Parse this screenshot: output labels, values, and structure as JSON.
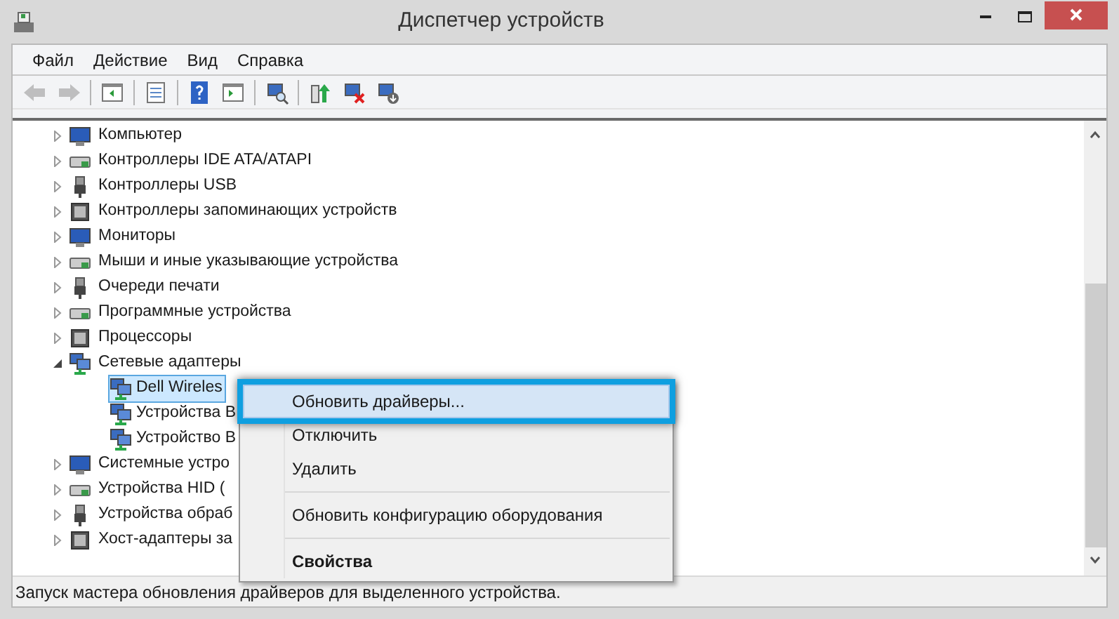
{
  "window": {
    "title": "Диспетчер устройств"
  },
  "menu_bar": [
    "Файл",
    "Действие",
    "Вид",
    "Справка"
  ],
  "toolbar": [
    {
      "kind": "back",
      "disabled": true
    },
    {
      "kind": "forward",
      "disabled": true
    },
    {
      "kind": "separator"
    },
    {
      "kind": "tree"
    },
    {
      "kind": "separator"
    },
    {
      "kind": "properties"
    },
    {
      "kind": "separator"
    },
    {
      "kind": "help"
    },
    {
      "kind": "pane"
    },
    {
      "kind": "separator"
    },
    {
      "kind": "scan"
    },
    {
      "kind": "separator"
    },
    {
      "kind": "update"
    },
    {
      "kind": "uninstall"
    },
    {
      "kind": "disable"
    }
  ],
  "tree": [
    {
      "label": "Компьютер",
      "expanded": false,
      "selected": false
    },
    {
      "label": "Контроллеры IDE ATA/ATAPI",
      "expanded": false,
      "selected": false
    },
    {
      "label": "Контроллеры USB",
      "expanded": false,
      "selected": false
    },
    {
      "label": "Контроллеры запоминающих устройств",
      "expanded": false,
      "selected": false
    },
    {
      "label": "Мониторы",
      "expanded": false,
      "selected": false
    },
    {
      "label": "Мыши и иные указывающие устройства",
      "expanded": false,
      "selected": false
    },
    {
      "label": "Очереди печати",
      "expanded": false,
      "selected": false
    },
    {
      "label": "Программные устройства",
      "expanded": false,
      "selected": false
    },
    {
      "label": "Процессоры",
      "expanded": false,
      "selected": false
    },
    {
      "label": "Сетевые адаптеры",
      "expanded": true,
      "selected": false,
      "children": [
        {
          "label": "Dell Wireles",
          "selected": true
        },
        {
          "label": "Устройства B",
          "selected": false
        },
        {
          "label": "Устройство B",
          "selected": false
        }
      ]
    },
    {
      "label": "Системные устро",
      "expanded": false,
      "selected": false
    },
    {
      "label": "Устройства HID (",
      "expanded": false,
      "selected": false
    },
    {
      "label": "Устройства обраб",
      "expanded": false,
      "selected": false
    },
    {
      "label": "Хост-адаптеры за",
      "expanded": false,
      "selected": false
    }
  ],
  "context_menu": [
    {
      "kind": "item",
      "label": "Обновить драйверы...",
      "selected": true,
      "default": false
    },
    {
      "kind": "item",
      "label": "Отключить",
      "selected": false,
      "default": false
    },
    {
      "kind": "item",
      "label": "Удалить",
      "selected": false,
      "default": false
    },
    {
      "kind": "separator"
    },
    {
      "kind": "item",
      "label": "Обновить конфигурацию оборудования",
      "selected": false,
      "default": false
    },
    {
      "kind": "separator"
    },
    {
      "kind": "item",
      "label": "Свойства",
      "selected": false,
      "default": true
    }
  ],
  "status_bar": "Запуск мастера обновления драйверов для выделенного устройства."
}
